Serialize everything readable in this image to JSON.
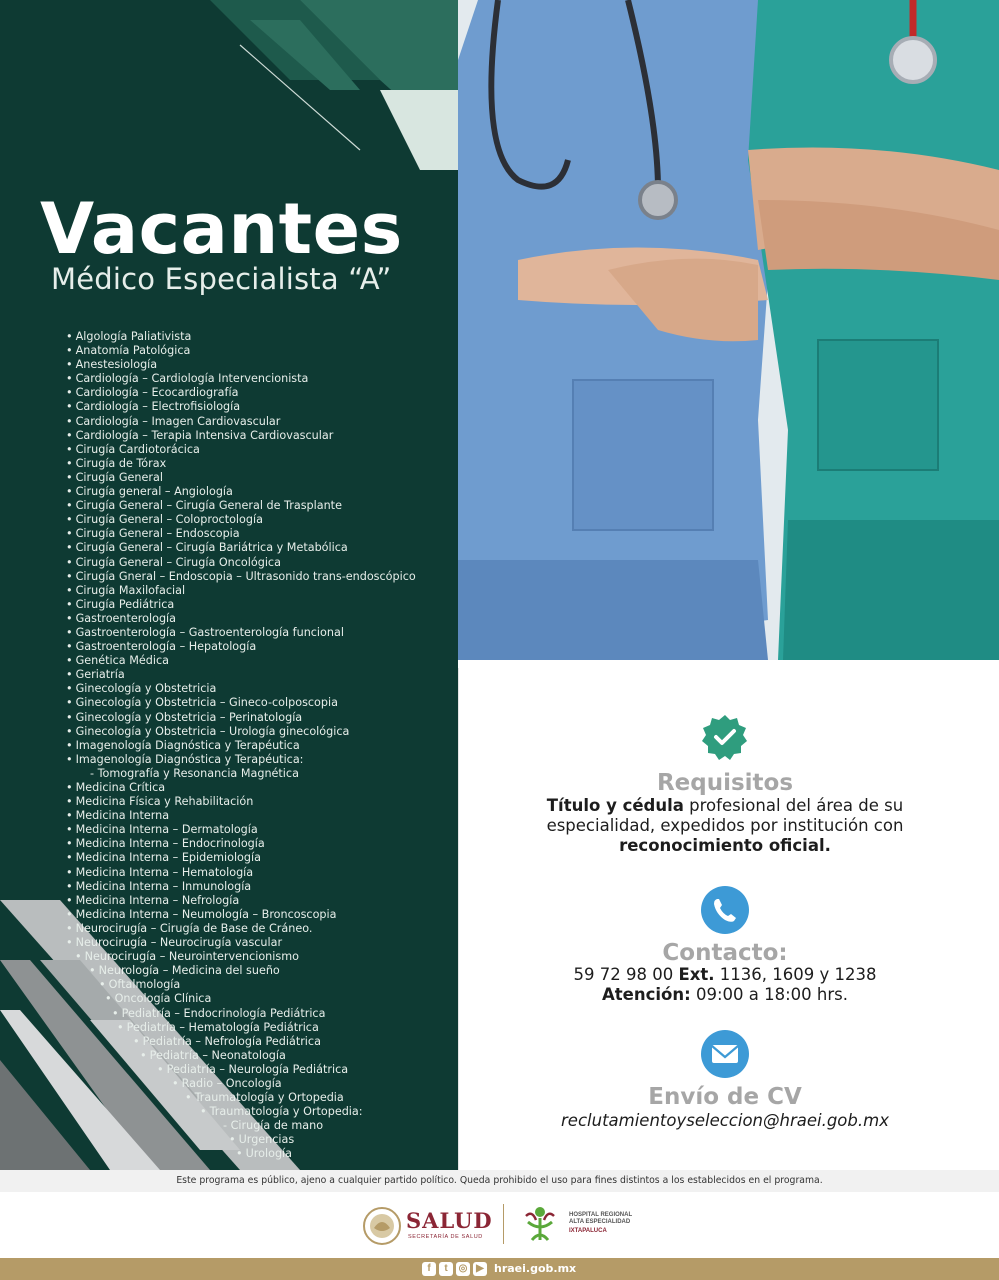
{
  "left": {
    "title": "Vacantes",
    "subtitle": "Médico Especialista “A”",
    "specialties": [
      {
        "text": "Algología Paliativista",
        "bullet": true,
        "indent": 0
      },
      {
        "text": "Anatomía Patológica",
        "bullet": true,
        "indent": 0
      },
      {
        "text": "Anestesiología",
        "bullet": true,
        "indent": 0
      },
      {
        "text": "Cardiología – Cardiología Intervencionista",
        "bullet": true,
        "indent": 0
      },
      {
        "text": "Cardiología – Ecocardiografía",
        "bullet": true,
        "indent": 0
      },
      {
        "text": "Cardiología – Electrofisiología",
        "bullet": true,
        "indent": 0
      },
      {
        "text": "Cardiología – Imagen Cardiovascular",
        "bullet": true,
        "indent": 0
      },
      {
        "text": "Cardiología – Terapia Intensiva Cardiovascular",
        "bullet": true,
        "indent": 0
      },
      {
        "text": "Cirugía Cardiotorácica",
        "bullet": true,
        "indent": 0
      },
      {
        "text": "Cirugía de Tórax",
        "bullet": true,
        "indent": 0
      },
      {
        "text": "Cirugía General",
        "bullet": true,
        "indent": 0
      },
      {
        "text": "Cirugía general – Angiología",
        "bullet": true,
        "indent": 0
      },
      {
        "text": "Cirugía General – Cirugía General de Trasplante",
        "bullet": true,
        "indent": 0
      },
      {
        "text": "Cirugía General – Coloproctología",
        "bullet": true,
        "indent": 0
      },
      {
        "text": "Cirugía General – Endoscopia",
        "bullet": true,
        "indent": 0
      },
      {
        "text": "Cirugía General – Cirugía Bariátrica y Metabólica",
        "bullet": true,
        "indent": 0
      },
      {
        "text": "Cirugía General – Cirugía Oncológica",
        "bullet": true,
        "indent": 0
      },
      {
        "text": "Cirugía Gneral – Endoscopia – Ultrasonido trans-endoscópico",
        "bullet": true,
        "indent": 0
      },
      {
        "text": "Cirugía Maxilofacial",
        "bullet": true,
        "indent": 0
      },
      {
        "text": "Cirugía Pediátrica",
        "bullet": true,
        "indent": 0
      },
      {
        "text": "Gastroenterología",
        "bullet": true,
        "indent": 0
      },
      {
        "text": "Gastroenterología – Gastroenterología funcional",
        "bullet": true,
        "indent": 0
      },
      {
        "text": "Gastroenterología – Hepatología",
        "bullet": true,
        "indent": 0
      },
      {
        "text": "Genética Médica",
        "bullet": true,
        "indent": 0
      },
      {
        "text": "Geriatría",
        "bullet": true,
        "indent": 0
      },
      {
        "text": "Ginecología y Obstetricia",
        "bullet": true,
        "indent": 0
      },
      {
        "text": "Ginecología y Obstetricia – Gineco-colposcopia",
        "bullet": true,
        "indent": 0
      },
      {
        "text": "Ginecología y Obstetricia – Perinatología",
        "bullet": true,
        "indent": 0
      },
      {
        "text": "Ginecología y Obstetricia – Urología ginecológica",
        "bullet": true,
        "indent": 0
      },
      {
        "text": "Imagenología Diagnóstica y Terapéutica",
        "bullet": true,
        "indent": 0
      },
      {
        "text": "Imagenología Diagnóstica y Terapéutica:",
        "bullet": true,
        "indent": 0
      },
      {
        "text": "- Tomografía y Resonancia Magnética",
        "bullet": false,
        "indent": 24
      },
      {
        "text": "Medicina Crítica",
        "bullet": true,
        "indent": 0
      },
      {
        "text": "Medicina Física y Rehabilitación",
        "bullet": true,
        "indent": 0
      },
      {
        "text": "Medicina Interna",
        "bullet": true,
        "indent": 0
      },
      {
        "text": "Medicina Interna – Dermatología",
        "bullet": true,
        "indent": 0
      },
      {
        "text": "Medicina Interna – Endocrinología",
        "bullet": true,
        "indent": 0
      },
      {
        "text": "Medicina Interna – Epidemiología",
        "bullet": true,
        "indent": 0
      },
      {
        "text": "Medicina Interna – Hematología",
        "bullet": true,
        "indent": 0
      },
      {
        "text": "Medicina Interna – Inmunología",
        "bullet": true,
        "indent": 0
      },
      {
        "text": "Medicina Interna – Nefrología",
        "bullet": true,
        "indent": 0
      },
      {
        "text": "Medicina Interna – Neumología – Broncoscopia",
        "bullet": true,
        "indent": 0
      },
      {
        "text": "Neurocirugía – Cirugía de Base de Cráneo.",
        "bullet": true,
        "indent": 0
      },
      {
        "text": "Neurocirugía – Neurocirugía vascular",
        "bullet": true,
        "indent": 0
      },
      {
        "text": "Neurocirugía – Neurointervencionismo",
        "bullet": true,
        "indent": 9
      },
      {
        "text": "Neurología – Medicina del sueño",
        "bullet": true,
        "indent": 23
      },
      {
        "text": "Oftalmología",
        "bullet": true,
        "indent": 33
      },
      {
        "text": "Oncología Clínica",
        "bullet": true,
        "indent": 39
      },
      {
        "text": "Pediatría – Endocrinología Pediátrica",
        "bullet": true,
        "indent": 46
      },
      {
        "text": "Pediatría – Hematología Pediátrica",
        "bullet": true,
        "indent": 51
      },
      {
        "text": "Pediatría – Nefrología Pediátrica",
        "bullet": true,
        "indent": 67
      },
      {
        "text": "Pediatría – Neonatología",
        "bullet": true,
        "indent": 74
      },
      {
        "text": "Pediatría – Neurología Pediátrica",
        "bullet": true,
        "indent": 91
      },
      {
        "text": "Radio – Oncología",
        "bullet": true,
        "indent": 106
      },
      {
        "text": "Traumatología y Ortopedia",
        "bullet": true,
        "indent": 119
      },
      {
        "text": "Traumatología y Ortopedia:",
        "bullet": true,
        "indent": 134
      },
      {
        "text": "- Cirugía de mano",
        "bullet": false,
        "indent": 157
      },
      {
        "text": "Urgencias",
        "bullet": true,
        "indent": 163
      },
      {
        "text": "Urología",
        "bullet": true,
        "indent": 170
      }
    ]
  },
  "requisitos": {
    "heading": "Requisitos",
    "line1_bold": "Título y cédula",
    "line1_rest": " profesional del área de su",
    "line2": "especialidad, expedidos por institución con",
    "line3_bold": "reconocimiento oficial."
  },
  "contacto": {
    "heading": "Contacto:",
    "phone": "59 72 98 00",
    "ext_label": "Ext.",
    "ext_values": " 1136, 1609 y 1238",
    "hours_label": "Atención:",
    "hours_value": " 09:00 a 18:00 hrs."
  },
  "cv": {
    "heading": "Envío de CV",
    "email": "reclutamientoyseleccion@hraei.gob.mx"
  },
  "footer": {
    "disclaimer": "Este programa es público, ajeno a cualquier partido político. Queda prohibido el uso para fines distintos a los establecidos en el programa.",
    "salud_logo_text": "SALUD",
    "salud_subtitle": "SECRETARÍA DE SALUD",
    "hospital_text_1": "HOSPITAL REGIONAL",
    "hospital_text_2": "ALTA ESPECIALIDAD",
    "hospital_text_3": "IXTAPALUCA",
    "website": "hraei.gob.mx",
    "social_icons": [
      "facebook-icon",
      "twitter-icon",
      "instagram-icon",
      "youtube-icon"
    ]
  },
  "colors": {
    "panel_green": "#0e3a33",
    "accent_teal": "#2f9d7e",
    "icon_blue": "#3d9ad6",
    "gold": "#b59b67",
    "salud_red": "#8b2635"
  }
}
